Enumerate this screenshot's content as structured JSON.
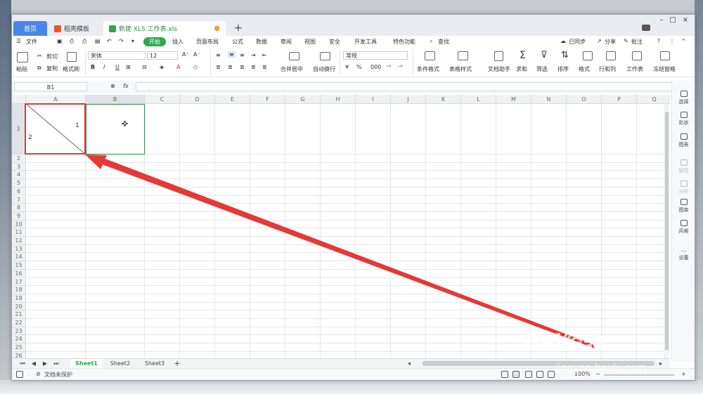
{
  "tabs": {
    "home": "首页",
    "template": "稻壳模板",
    "file": "新建 XLS 工作表.xls",
    "new_tab": "+"
  },
  "window_controls": {
    "minimize": "–",
    "maximize": "□",
    "close": "×"
  },
  "menu": {
    "file": "文件",
    "start": "开始",
    "items": [
      "插入",
      "页面布局",
      "公式",
      "数据",
      "审阅",
      "视图",
      "安全",
      "开发工具",
      "特色功能"
    ],
    "search": "查找",
    "right": [
      "已同步",
      "分享",
      "批注"
    ]
  },
  "ribbon": {
    "paste": "粘贴",
    "cut": "剪切",
    "copy": "复制",
    "format_painter": "格式刷",
    "font_name": "宋体",
    "font_size": "12",
    "bold": "B",
    "italic": "I",
    "underline": "U",
    "merge": "合并居中",
    "wrap": "自动换行",
    "number_format": "常规",
    "conditional": "条件格式",
    "table_style": "表格样式",
    "doc_helper": "文档助手",
    "sum": "求和",
    "filter": "筛选",
    "sort": "排序",
    "format": "格式",
    "row_col": "行和列",
    "worksheet": "工作表",
    "freeze": "冻结窗格"
  },
  "formula_bar": {
    "cell_ref": "B1",
    "fx": "fx",
    "content": ""
  },
  "columns": [
    "A",
    "B",
    "C",
    "D",
    "E",
    "F",
    "G",
    "H",
    "I",
    "J",
    "K",
    "L",
    "M",
    "N",
    "O",
    "P",
    "Q"
  ],
  "rows": [
    "1",
    "2",
    "3",
    "4",
    "5",
    "6",
    "7",
    "8",
    "9",
    "10",
    "11",
    "12",
    "13",
    "14",
    "15",
    "16",
    "17",
    "18",
    "19",
    "20",
    "21",
    "22",
    "23",
    "24",
    "25",
    "26"
  ],
  "cell_a1": {
    "top_right": "1",
    "bottom_left": "2"
  },
  "sidepanel": [
    {
      "label": "选择",
      "icon": "cursor-icon",
      "enabled": true
    },
    {
      "label": "形状",
      "icon": "shapes-icon",
      "enabled": true
    },
    {
      "label": "图表",
      "icon": "chart-icon",
      "enabled": true
    },
    {
      "label": "属性",
      "icon": "property-icon",
      "enabled": false
    },
    {
      "label": "分析",
      "icon": "analysis-icon",
      "enabled": false
    },
    {
      "label": "图库",
      "icon": "gallery-icon",
      "enabled": true
    },
    {
      "label": "风格",
      "icon": "style-icon",
      "enabled": true
    },
    {
      "label": "设置",
      "icon": "settings-icon",
      "enabled": true
    }
  ],
  "sheets": [
    "Sheet1",
    "Sheet2",
    "Sheet3"
  ],
  "active_sheet": "Sheet1",
  "status": {
    "protect": "文档未保护",
    "zoom": "100%"
  },
  "watermark": {
    "text": "Bai经验",
    "sub": "jingyan.baidu.com"
  },
  "colors": {
    "accent_green": "#2fa84f",
    "home_tab": "#4a86e8",
    "annotation_red": "#e53935",
    "selection_green": "#2e8b4a"
  }
}
